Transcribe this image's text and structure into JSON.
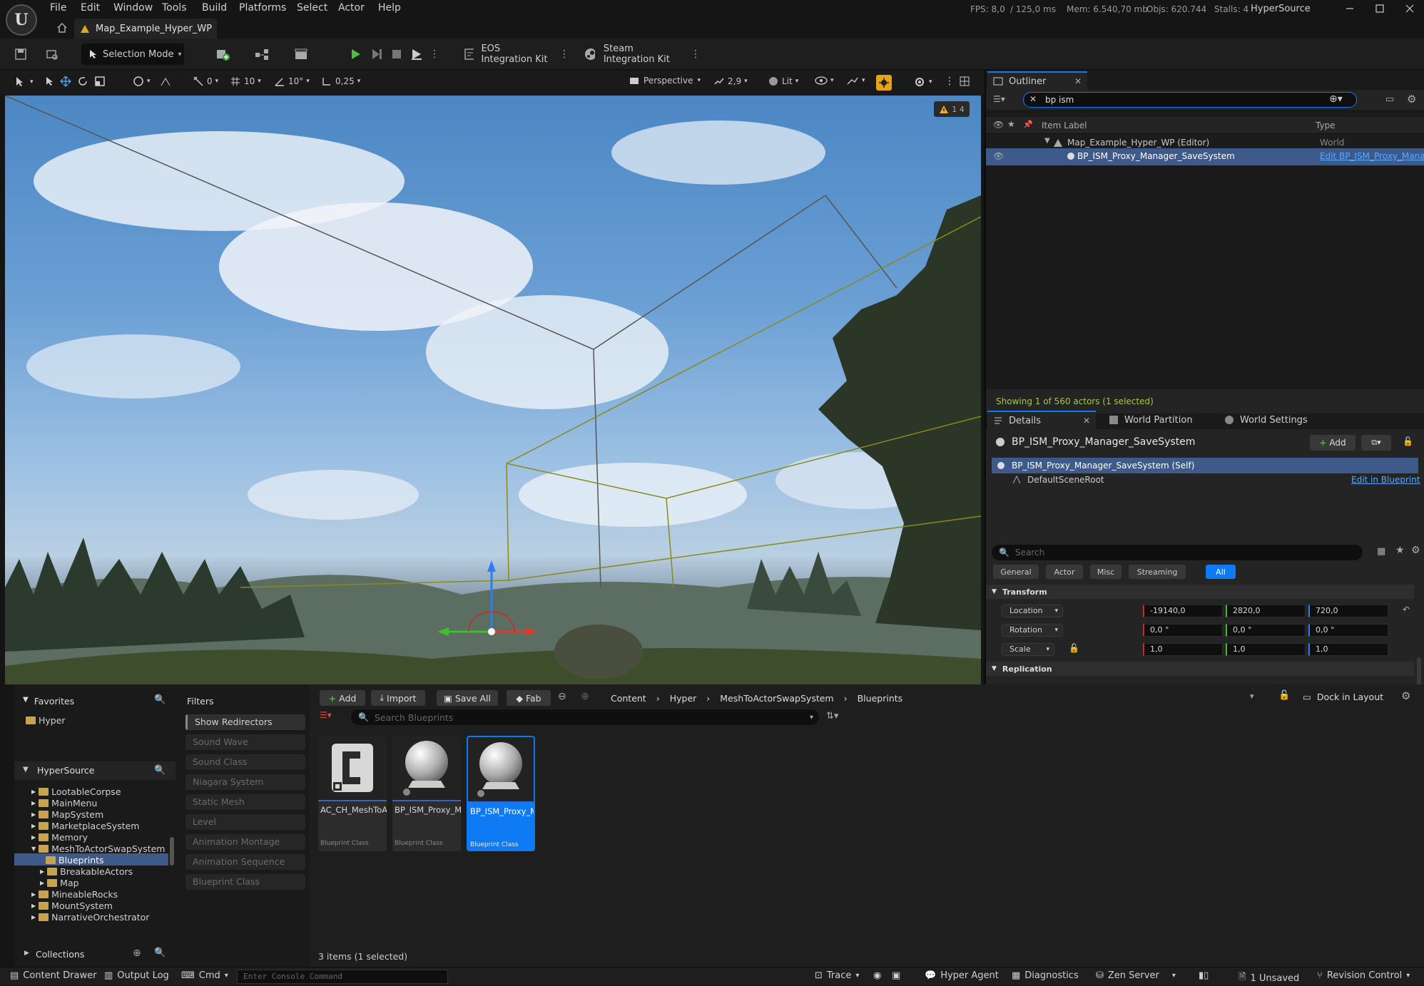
{
  "titlebar": {
    "menu": [
      "File",
      "Edit",
      "Window",
      "Tools",
      "Build",
      "Platforms",
      "Select",
      "Actor",
      "Help"
    ],
    "level_tab": "Map_Example_Hyper_WP",
    "stats": {
      "fps": "FPS: 8,0",
      "ms": "/ 125,0 ms",
      "mem": "Mem: 6.540,70 mb",
      "objs": "Objs: 620.744",
      "stalls": "Stalls: 4"
    },
    "project_name": "HyperSource"
  },
  "toolbar": {
    "selection_mode": "Selection Mode",
    "eos_kit": "EOS Integration Kit",
    "steam_kit": "Steam Integration Kit"
  },
  "viewport_toolbar": {
    "rotation_snap_count": "0",
    "grid_snap": "10",
    "rotate_snap": "10°",
    "scale_snap": "0,25",
    "view_mode": "Perspective",
    "camera_speed": "2,9",
    "lighting": "Lit",
    "warning_count": "1 4"
  },
  "outliner": {
    "tab_label": "Outliner",
    "search_value": "bp ism",
    "col_label": "Item Label",
    "col_type": "Type",
    "rows": [
      {
        "label": "Map_Example_Hyper_WP (Editor)",
        "type": "World"
      },
      {
        "label": "BP_ISM_Proxy_Manager_SaveSystem",
        "type": "Edit BP_ISM_Proxy_Mana"
      }
    ],
    "status": "Showing 1 of 560 actors (1 selected)"
  },
  "details": {
    "tabs": [
      "Details",
      "World Partition",
      "World Settings"
    ],
    "object_name": "BP_ISM_Proxy_Manager_SaveSystem",
    "add_label": "Add",
    "self_row": "BP_ISM_Proxy_Manager_SaveSystem (Self)",
    "component": "DefaultSceneRoot",
    "edit_in_blueprint": "Edit in Blueprint",
    "search_placeholder": "Search",
    "categories": [
      "General",
      "Actor",
      "Misc",
      "Streaming",
      "All"
    ],
    "transform_label": "Transform",
    "location_label": "Location",
    "rotation_label": "Rotation",
    "scale_label": "Scale",
    "location": [
      "-19140,0",
      "2820,0",
      "720,0"
    ],
    "rotation": [
      "0,0 °",
      "0,0 °",
      "0,0 °"
    ],
    "scale": [
      "1,0",
      "1,0",
      "1,0"
    ],
    "replication_label": "Replication"
  },
  "content_browser": {
    "favorites_label": "Favorites",
    "favorites": [
      "Hyper"
    ],
    "source_label": "HyperSource",
    "tree": [
      {
        "label": "LootableCorpse",
        "depth": 0
      },
      {
        "label": "MainMenu",
        "depth": 0
      },
      {
        "label": "MapSystem",
        "depth": 0
      },
      {
        "label": "MarketplaceSystem",
        "depth": 0
      },
      {
        "label": "Memory",
        "depth": 0
      },
      {
        "label": "MeshToActorSwapSystem",
        "depth": 0
      },
      {
        "label": "Blueprints",
        "depth": 1
      },
      {
        "label": "BreakableActors",
        "depth": 1
      },
      {
        "label": "Map",
        "depth": 1
      },
      {
        "label": "MineableRocks",
        "depth": 0
      },
      {
        "label": "MountSystem",
        "depth": 0
      },
      {
        "label": "NarrativeOrchestrator",
        "depth": 0
      }
    ],
    "collections_label": "Collections",
    "filters_label": "Filters",
    "filters": [
      "Show Redirectors",
      "Sound Wave",
      "Sound Class",
      "Niagara System",
      "Static Mesh",
      "Level",
      "Animation Montage",
      "Animation Sequence",
      "Blueprint Class"
    ],
    "add_label": "Add",
    "import_label": "Import",
    "save_all_label": "Save All",
    "fab_label": "Fab",
    "breadcrumb": [
      "Content",
      "Hyper",
      "MeshToActorSwapSystem",
      "Blueprints"
    ],
    "dock_label": "Dock in Layout",
    "search_placeholder": "Search Blueprints",
    "assets": [
      {
        "name": "AC_CH_MeshToActor_Swapper",
        "type": "Blueprint Class"
      },
      {
        "name": "BP_ISM_Proxy_Manager",
        "type": "Blueprint Class"
      },
      {
        "name": "BP_ISM_Proxy_Manager_SaveSystem",
        "type": "Blueprint Class"
      }
    ],
    "items_status": "3 items (1 selected)"
  },
  "statusbar": {
    "content_drawer": "Content Drawer",
    "output_log": "Output Log",
    "cmd": "Cmd",
    "console_placeholder": "Enter Console Command",
    "trace": "Trace",
    "hyper_agent": "Hyper Agent",
    "diagnostics": "Diagnostics",
    "zen_server": "Zen Server",
    "unsaved": "1 Unsaved",
    "revision_control": "Revision Control"
  },
  "colors": {
    "accent": "#0e7bf5",
    "selection": "#3d5a8a",
    "gold": "#c9a250"
  }
}
